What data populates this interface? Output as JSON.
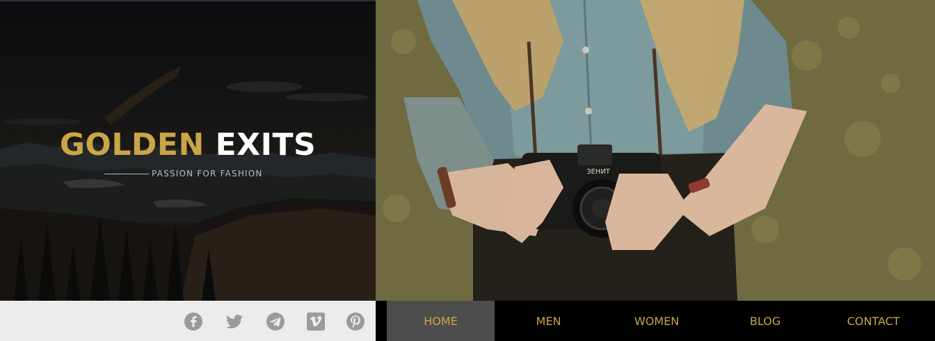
{
  "brand": {
    "title_gold": "GOLDEN",
    "title_white": "EXITS",
    "tagline": "PASSION FOR FASHION"
  },
  "social": {
    "items": [
      {
        "icon": "facebook-icon",
        "label": "Facebook"
      },
      {
        "icon": "twitter-icon",
        "label": "Twitter"
      },
      {
        "icon": "telegram-icon",
        "label": "Telegram"
      },
      {
        "icon": "vimeo-icon",
        "label": "Vimeo"
      },
      {
        "icon": "pinterest-icon",
        "label": "Pinterest"
      }
    ]
  },
  "nav": {
    "items": [
      {
        "label": "HOME",
        "active": true
      },
      {
        "label": "MEN",
        "active": false
      },
      {
        "label": "WOMEN",
        "active": false
      },
      {
        "label": "BLOG",
        "active": false
      },
      {
        "label": "CONTACT",
        "active": false
      }
    ]
  },
  "colors": {
    "accent_gold": "#c9a646",
    "nav_active_bg": "#4d4d4d",
    "social_bar_bg": "#ececec",
    "social_icon": "#9a9a9a"
  }
}
